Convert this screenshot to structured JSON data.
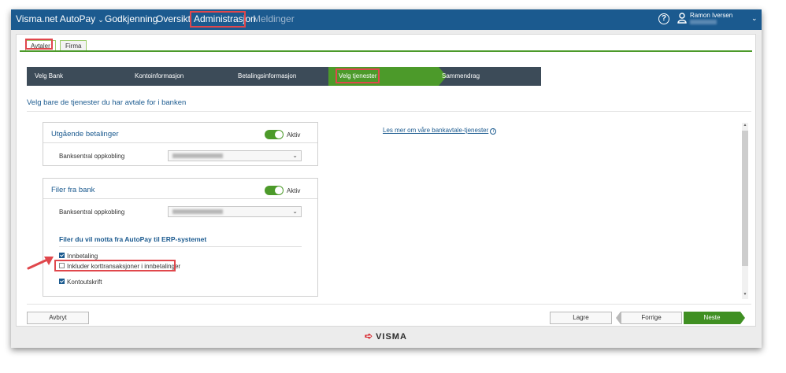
{
  "topbar": {
    "brand": "Visma.net AutoPay",
    "nav": [
      "Godkjenning",
      "Oversikt",
      "Administrasjon",
      "Meldinger"
    ],
    "user_name": "Ramon Iversen"
  },
  "tabs": [
    "Avtaler",
    "Firma"
  ],
  "wizard": {
    "steps": [
      "Velg Bank",
      "Kontoinformasjon",
      "Betalingsinformasjon",
      "Velg tjenester",
      "Sammendrag"
    ],
    "active": "Velg tjenester"
  },
  "intro": "Velg bare de tjenester du har avtale for i banken",
  "link": "Les mer om våre bankavtale-tjenester",
  "panel1": {
    "title": "Utgående betalinger",
    "toggle_label": "Aktiv",
    "field_label": "Banksentral oppkobling"
  },
  "panel2": {
    "title": "Filer fra bank",
    "toggle_label": "Aktiv",
    "field_label": "Banksentral oppkobling",
    "section_title": "Filer du vil motta fra AutoPay til ERP-systemet",
    "checkboxes": [
      {
        "label": "Innbetaling",
        "checked": true
      },
      {
        "label": "Inkluder korttransaksjoner i innbetalinger",
        "checked": false
      },
      {
        "label": "Kontoutskrift",
        "checked": true
      }
    ]
  },
  "buttons": {
    "cancel": "Avbryt",
    "save": "Lagre",
    "prev": "Forrige",
    "next": "Neste"
  },
  "footer": {
    "logo": "VISMA"
  },
  "colors": {
    "topbar": "#1b5a8f",
    "accent_green": "#4c9a2a",
    "highlight_red": "#e0474c"
  }
}
